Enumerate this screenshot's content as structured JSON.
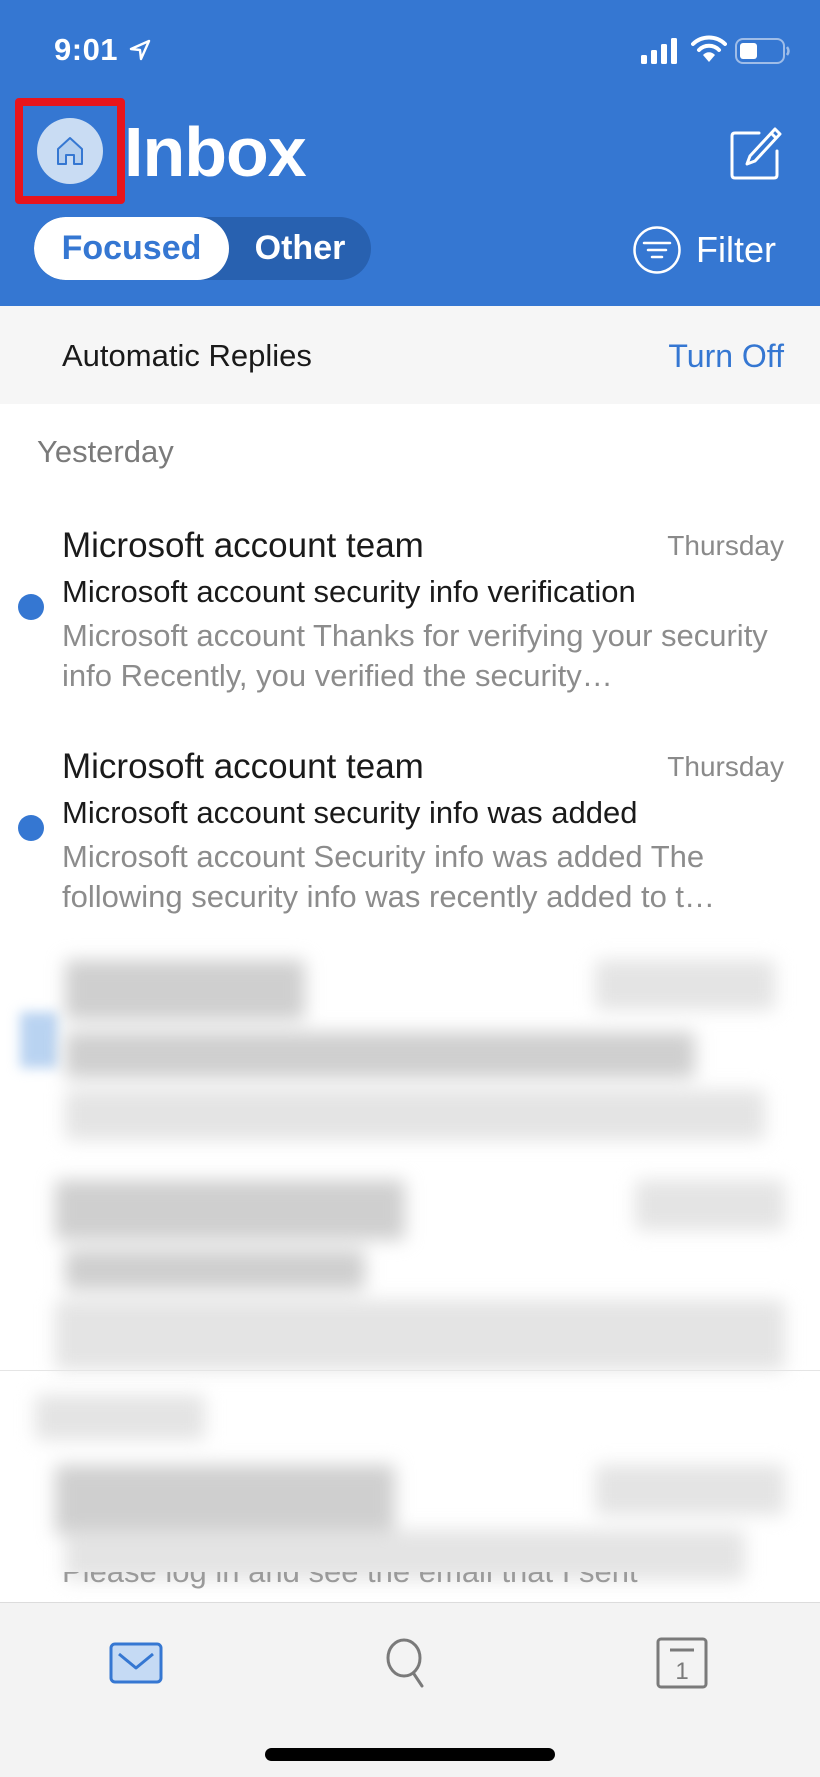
{
  "status_bar": {
    "time": "9:01",
    "icons": [
      "location-arrow-icon",
      "cellular-signal-icon",
      "wifi-icon",
      "battery-icon"
    ]
  },
  "header": {
    "title": "Inbox",
    "home_icon": "home-icon",
    "compose_icon": "compose-icon",
    "pivot": {
      "tabs": [
        {
          "label": "Focused",
          "selected": true
        },
        {
          "label": "Other",
          "selected": false
        }
      ]
    },
    "filter_label": "Filter"
  },
  "automatic_replies": {
    "label": "Automatic Replies",
    "action": "Turn Off"
  },
  "mail_list": {
    "section": "Yesterday",
    "items": [
      {
        "sender": "Microsoft account team",
        "date": "Thursday",
        "subject": "Microsoft account security info verification",
        "preview": "Microsoft account Thanks for verifying your security info Recently, you verified the security…",
        "unread": true
      },
      {
        "sender": "Microsoft account team",
        "date": "Thursday",
        "subject": "Microsoft account security info was added",
        "preview": "Microsoft account Security info was added The following security info was recently added to t…",
        "unread": true
      }
    ],
    "partial_preview": "Please log in and see the email that I sent"
  },
  "tab_bar": {
    "tabs": [
      {
        "name": "mail",
        "icon": "mail-icon",
        "selected": true
      },
      {
        "name": "search",
        "icon": "search-icon",
        "selected": false
      },
      {
        "name": "calendar",
        "icon": "calendar-icon",
        "calendar_day": "1",
        "selected": false
      }
    ]
  },
  "colors": {
    "brand_blue": "#3577d2",
    "pivot_dark": "#2861b0",
    "highlight_box": "#e8141c"
  }
}
